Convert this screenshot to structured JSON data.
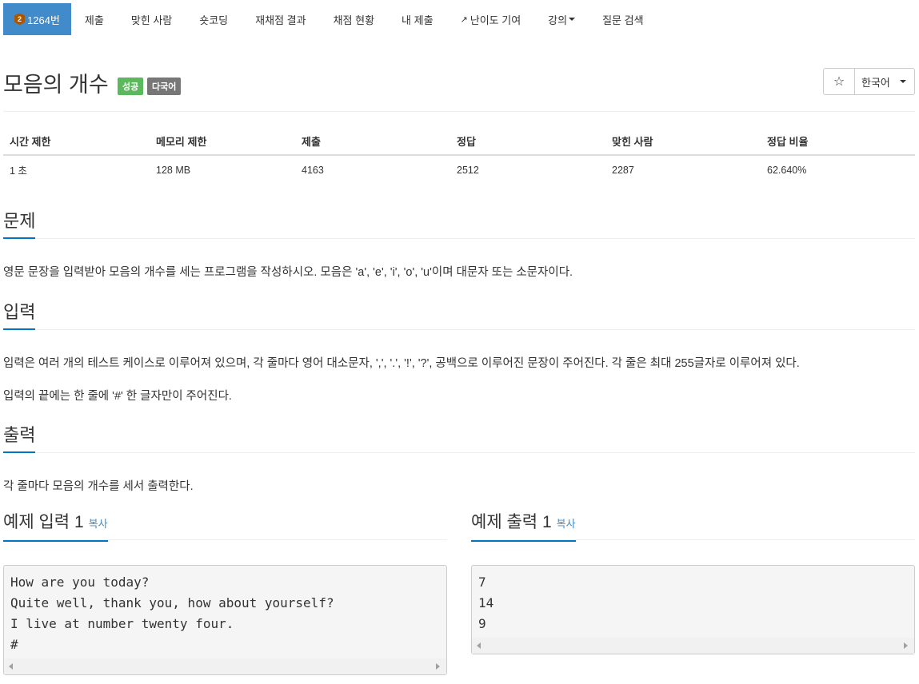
{
  "nav": {
    "problem_tab": "1264번",
    "tier_icon": "bronze-tier-icon",
    "tier_text": "2",
    "tabs": [
      "제출",
      "맞힌 사람",
      "숏코딩",
      "재채점 결과",
      "채점 현황",
      "내 제출"
    ],
    "difficulty_tab": "난이도 기여",
    "lecture_tab": "강의",
    "search_tab": "질문 검색"
  },
  "header": {
    "title": "모음의 개수",
    "badge_success": "성공",
    "badge_lang": "다국어",
    "star": "☆",
    "language": "한국어"
  },
  "stats": {
    "headers": [
      "시간 제한",
      "메모리 제한",
      "제출",
      "정답",
      "맞힌 사람",
      "정답 비율"
    ],
    "values": [
      "1 초",
      "128 MB",
      "4163",
      "2512",
      "2287",
      "62.640%"
    ]
  },
  "problem": {
    "heading": "문제",
    "text": "영문 문장을 입력받아 모음의 개수를 세는 프로그램을 작성하시오. 모음은 'a', 'e', 'i', 'o', 'u'이며 대문자 또는 소문자이다."
  },
  "input": {
    "heading": "입력",
    "text1": "입력은 여러 개의 테스트 케이스로 이루어져 있으며, 각 줄마다 영어 대소문자, ',', '.', '!', '?', 공백으로 이루어진 문장이 주어진다. 각 줄은 최대 255글자로 이루어져 있다.",
    "text2": "입력의 끝에는 한 줄에 '#' 한 글자만이 주어진다."
  },
  "output": {
    "heading": "출력",
    "text": "각 줄마다 모음의 개수를 세서 출력한다."
  },
  "sample_input": {
    "heading": "예제 입력 1",
    "copy": "복사",
    "content": "How are you today?\nQuite well, thank you, how about yourself?\nI live at number twenty four.\n#"
  },
  "sample_output": {
    "heading": "예제 출력 1",
    "copy": "복사",
    "content": "7\n14\n9"
  }
}
